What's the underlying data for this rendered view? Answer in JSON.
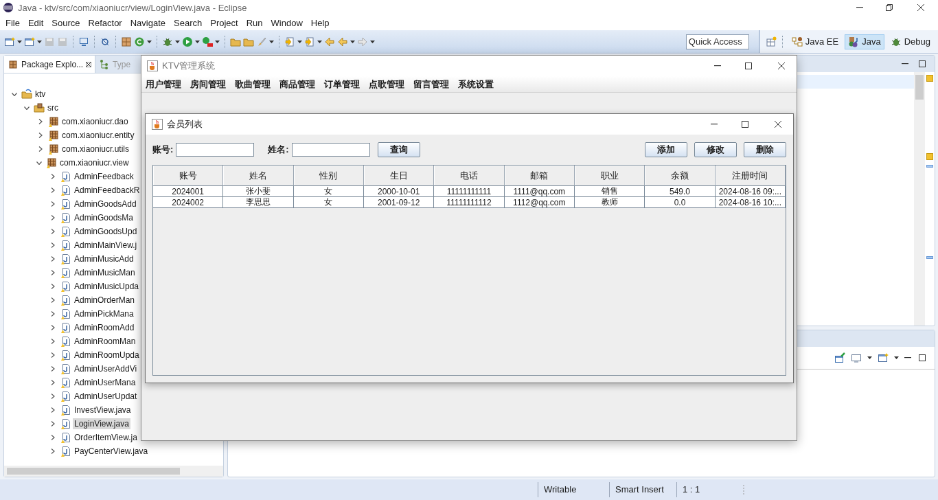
{
  "window": {
    "title": "Java - ktv/src/com/xiaoniucr/view/LoginView.java - Eclipse"
  },
  "menu": [
    "File",
    "Edit",
    "Source",
    "Refactor",
    "Navigate",
    "Search",
    "Project",
    "Run",
    "Window",
    "Help"
  ],
  "quick_access": {
    "placeholder": "Quick Access"
  },
  "perspectives": [
    {
      "label": "Java EE",
      "selected": false
    },
    {
      "label": "Java",
      "selected": true
    },
    {
      "label": "Debug",
      "selected": false
    }
  ],
  "explorer": {
    "tabs": [
      {
        "label": "Package Explo...",
        "selected": true
      },
      {
        "label": "Type",
        "selected": false
      }
    ],
    "tree": [
      {
        "label": "ktv",
        "kind": "project",
        "expanded": true,
        "selected": false,
        "children": [
          {
            "label": "src",
            "kind": "folder",
            "expanded": true,
            "selected": false,
            "children": [
              {
                "label": "com.xiaoniucr.dao",
                "kind": "package",
                "expanded": false,
                "selected": false
              },
              {
                "label": "com.xiaoniucr.entity",
                "kind": "package",
                "expanded": false,
                "selected": false
              },
              {
                "label": "com.xiaoniucr.utils",
                "kind": "package",
                "expanded": false,
                "selected": false
              },
              {
                "label": "com.xiaoniucr.view",
                "kind": "package",
                "expanded": true,
                "selected": false,
                "children": [
                  {
                    "label": "AdminFeedback",
                    "kind": "file",
                    "expanded": false,
                    "selected": false
                  },
                  {
                    "label": "AdminFeedbackR",
                    "kind": "file",
                    "expanded": false,
                    "selected": false
                  },
                  {
                    "label": "AdminGoodsAdd",
                    "kind": "file",
                    "expanded": false,
                    "selected": false
                  },
                  {
                    "label": "AdminGoodsMa",
                    "kind": "file",
                    "expanded": false,
                    "selected": false
                  },
                  {
                    "label": "AdminGoodsUpd",
                    "kind": "file",
                    "expanded": false,
                    "selected": false
                  },
                  {
                    "label": "AdminMainView.j",
                    "kind": "file",
                    "expanded": false,
                    "selected": false
                  },
                  {
                    "label": "AdminMusicAdd",
                    "kind": "file",
                    "expanded": false,
                    "selected": false
                  },
                  {
                    "label": "AdminMusicMan",
                    "kind": "file",
                    "expanded": false,
                    "selected": false
                  },
                  {
                    "label": "AdminMusicUpda",
                    "kind": "file",
                    "expanded": false,
                    "selected": false
                  },
                  {
                    "label": "AdminOrderMan",
                    "kind": "file",
                    "expanded": false,
                    "selected": false
                  },
                  {
                    "label": "AdminPickMana",
                    "kind": "file",
                    "expanded": false,
                    "selected": false
                  },
                  {
                    "label": "AdminRoomAdd",
                    "kind": "file",
                    "expanded": false,
                    "selected": false
                  },
                  {
                    "label": "AdminRoomMan",
                    "kind": "file",
                    "expanded": false,
                    "selected": false
                  },
                  {
                    "label": "AdminRoomUpda",
                    "kind": "file",
                    "expanded": false,
                    "selected": false
                  },
                  {
                    "label": "AdminUserAddVi",
                    "kind": "file",
                    "expanded": false,
                    "selected": false
                  },
                  {
                    "label": "AdminUserMana",
                    "kind": "file",
                    "expanded": false,
                    "selected": false
                  },
                  {
                    "label": "AdminUserUpdat",
                    "kind": "file",
                    "expanded": false,
                    "selected": false
                  },
                  {
                    "label": "InvestView.java",
                    "kind": "file",
                    "expanded": false,
                    "selected": false
                  },
                  {
                    "label": "LoginView.java",
                    "kind": "file",
                    "expanded": false,
                    "selected": true
                  },
                  {
                    "label": "OrderItemView.ja",
                    "kind": "file",
                    "expanded": false,
                    "selected": false
                  },
                  {
                    "label": "PayCenterView.java",
                    "kind": "file",
                    "expanded": false,
                    "selected": false
                  }
                ]
              }
            ]
          }
        ]
      }
    ]
  },
  "status_bar": [
    "Writable",
    "Smart Insert",
    "1 : 1"
  ],
  "app": {
    "title": "KTV管理系统",
    "menu": [
      "用户管理",
      "房间管理",
      "歌曲管理",
      "商品管理",
      "订单管理",
      "点歌管理",
      "留言管理",
      "系统设置"
    ],
    "dialog": {
      "title": "会员列表",
      "fields": [
        {
          "label": "账号:"
        },
        {
          "label": "姓名:"
        }
      ],
      "search_button": "查询",
      "actions": [
        "添加",
        "修改",
        "删除"
      ],
      "table": {
        "columns": [
          "账号",
          "姓名",
          "性别",
          "生日",
          "电话",
          "邮箱",
          "职业",
          "余额",
          "注册时间"
        ],
        "rows": [
          [
            "2024001",
            "张小斐",
            "女",
            "2000-10-01",
            "11111111111",
            "1111@qq.com",
            "销售",
            "549.0",
            "2024-08-16 09:..."
          ],
          [
            "2024002",
            "李思思",
            "女",
            "2001-09-12",
            "11111111112",
            "1112@qq.com",
            "教师",
            "0.0",
            "2024-08-16 10:..."
          ]
        ]
      }
    }
  }
}
